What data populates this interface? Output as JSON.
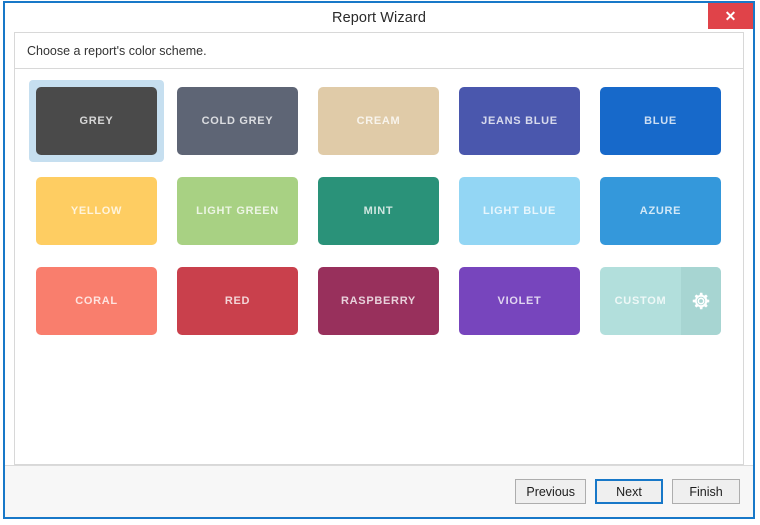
{
  "window": {
    "title": "Report Wizard",
    "close_icon": "close-icon",
    "close_label": "✕"
  },
  "header": {
    "instruction": "Choose a report's color scheme."
  },
  "schemes": [
    {
      "label": "GREY",
      "color": "#4a4a4a",
      "selected": true,
      "custom": false
    },
    {
      "label": "COLD GREY",
      "color": "#5e6575",
      "selected": false,
      "custom": false
    },
    {
      "label": "CREAM",
      "color": "#e0cba8",
      "selected": false,
      "custom": false
    },
    {
      "label": "JEANS BLUE",
      "color": "#4a57ad",
      "selected": false,
      "custom": false
    },
    {
      "label": "BLUE",
      "color": "#1769ca",
      "selected": false,
      "custom": false
    },
    {
      "label": "YELLOW",
      "color": "#fecd62",
      "selected": false,
      "custom": false
    },
    {
      "label": "LIGHT GREEN",
      "color": "#a8d183",
      "selected": false,
      "custom": false
    },
    {
      "label": "MINT",
      "color": "#2a9279",
      "selected": false,
      "custom": false
    },
    {
      "label": "LIGHT BLUE",
      "color": "#93d6f4",
      "selected": false,
      "custom": false
    },
    {
      "label": "AZURE",
      "color": "#3498db",
      "selected": false,
      "custom": false
    },
    {
      "label": "CORAL",
      "color": "#f97e6d",
      "selected": false,
      "custom": false
    },
    {
      "label": "RED",
      "color": "#c9404c",
      "selected": false,
      "custom": false
    },
    {
      "label": "RASPBERRY",
      "color": "#98305c",
      "selected": false,
      "custom": false
    },
    {
      "label": "VIOLET",
      "color": "#7745bd",
      "selected": false,
      "custom": false
    },
    {
      "label": "CUSTOM",
      "color": "#b2dfdc",
      "color_right": "#a7d5d2",
      "selected": false,
      "custom": true,
      "icon": "gear-icon"
    }
  ],
  "footer": {
    "previous_label": "Previous",
    "next_label": "Next",
    "finish_label": "Finish"
  },
  "colors": {
    "window_border": "#1878c8",
    "selection": "#c6dff0",
    "close_bg": "#e04349",
    "footer_bg": "#f7f7f7"
  }
}
